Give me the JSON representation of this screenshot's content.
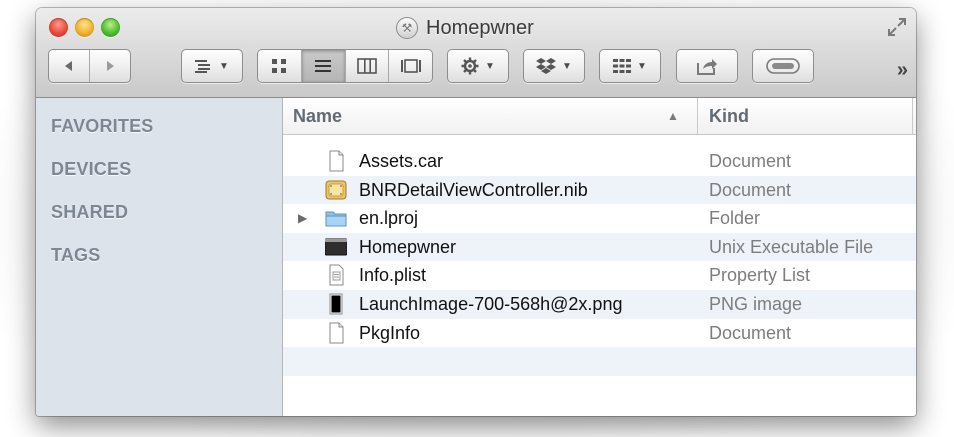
{
  "window": {
    "title": "Homepwner",
    "title_icon": "xcode-project-icon"
  },
  "toolbar": {
    "back_icon": "chevron-left-icon",
    "forward_icon": "chevron-right-icon",
    "arrange_icon": "list-arrange-icon",
    "view_modes": [
      "icon-view-icon",
      "list-view-icon",
      "column-view-icon",
      "coverflow-view-icon"
    ],
    "active_view": "list",
    "action_icon": "gear-icon",
    "dropbox_icon": "dropbox-icon",
    "group_icon": "grid-group-icon",
    "share_icon": "share-icon",
    "tags_icon": "tag-pill-icon",
    "overflow_label": "»"
  },
  "sidebar": {
    "sections": [
      "FAVORITES",
      "DEVICES",
      "SHARED",
      "TAGS"
    ]
  },
  "table": {
    "columns": {
      "name": "Name",
      "kind": "Kind",
      "sort": "ascending"
    },
    "rows": [
      {
        "name": "Assets.car",
        "kind": "Document",
        "icon": "document-icon",
        "expandable": false
      },
      {
        "name": "BNRDetailViewController.nib",
        "kind": "Document",
        "icon": "nib-file-icon",
        "expandable": false
      },
      {
        "name": "en.lproj",
        "kind": "Folder",
        "icon": "folder-icon",
        "expandable": true
      },
      {
        "name": "Homepwner",
        "kind": "Unix Executable File",
        "icon": "executable-icon",
        "expandable": false
      },
      {
        "name": "Info.plist",
        "kind": "Property List",
        "icon": "plist-icon",
        "expandable": false
      },
      {
        "name": "LaunchImage-700-568h@2x.png",
        "kind": "PNG image",
        "icon": "png-image-icon",
        "expandable": false
      },
      {
        "name": "PkgInfo",
        "kind": "Document",
        "icon": "document-icon",
        "expandable": false
      }
    ]
  },
  "colors": {
    "sidebar_bg": "#dde3ea",
    "row_alt": "#eef3fa",
    "close": "#e84b3a",
    "minimize": "#efb22d",
    "zoom": "#4fbf2d"
  }
}
